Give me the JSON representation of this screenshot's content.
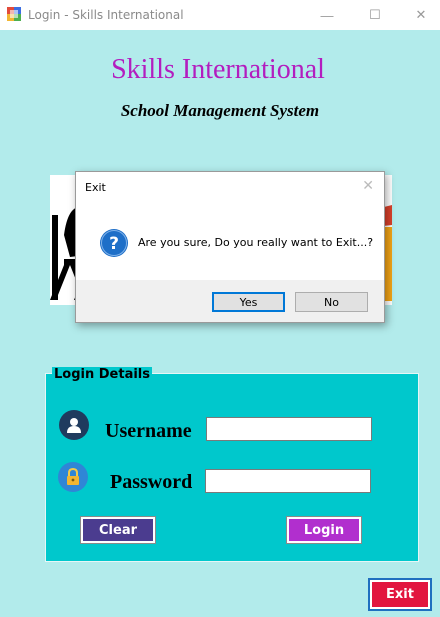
{
  "window": {
    "title": "Login - Skills International",
    "icon": "winforms-app-icon",
    "controls": {
      "minimize": "—",
      "maximize": "☐",
      "close": "✕"
    }
  },
  "header": {
    "title": "Skills International",
    "subtitle": "School Management System"
  },
  "banner": {
    "image": "school-banner-illustration"
  },
  "login_group": {
    "legend": "Login Details",
    "username_label": "Username",
    "username_value": "",
    "username_icon": "user-icon",
    "password_label": "Password",
    "password_value": "",
    "password_icon": "lock-icon",
    "clear_button": "Clear",
    "login_button": "Login"
  },
  "exit_button": "Exit",
  "dialog": {
    "title": "Exit",
    "close": "✕",
    "icon": "question-icon",
    "message": "Are you sure, Do you really want to Exit...?",
    "yes_button": "Yes",
    "no_button": "No"
  },
  "colors": {
    "background": "#b2ebeb",
    "heading": "#b31dbf",
    "group": "#00c8cc",
    "clear": "#4b3c8f",
    "login": "#b12fce",
    "exit": "#e2153f",
    "icon_circle": "#1f3b5e",
    "lock_circle": "#2f86d6"
  }
}
